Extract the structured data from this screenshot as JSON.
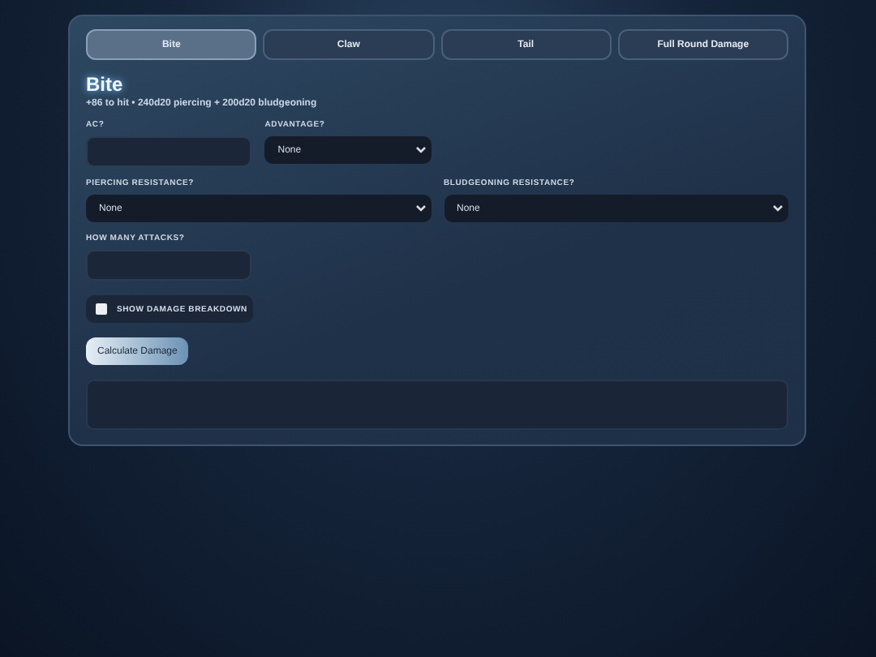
{
  "tabs": [
    {
      "label": "Bite",
      "selected": true
    },
    {
      "label": "Claw",
      "selected": false
    },
    {
      "label": "Tail",
      "selected": false
    },
    {
      "label": "Full Round Damage",
      "selected": false
    }
  ],
  "attack": {
    "title": "Bite",
    "summary": "+86 to hit • 240d20 piercing + 200d20 bludgeoning"
  },
  "field_rows": [
    [
      {
        "label": "AC?",
        "kind": "input"
      },
      {
        "label": "ADVANTAGE?",
        "kind": "select",
        "value": "None"
      }
    ],
    [
      {
        "label": "PIERCING RESISTANCE?",
        "kind": "select",
        "value": "None"
      },
      {
        "label": "BLUDGEONING RESISTANCE?",
        "kind": "select",
        "value": "None"
      }
    ],
    [
      {
        "label": "HOW MANY ATTACKS?",
        "kind": "input"
      }
    ]
  ],
  "breakdown": {
    "label": "SHOW DAMAGE BREAKDOWN",
    "checked": false
  },
  "button": "Calculate Damage"
}
